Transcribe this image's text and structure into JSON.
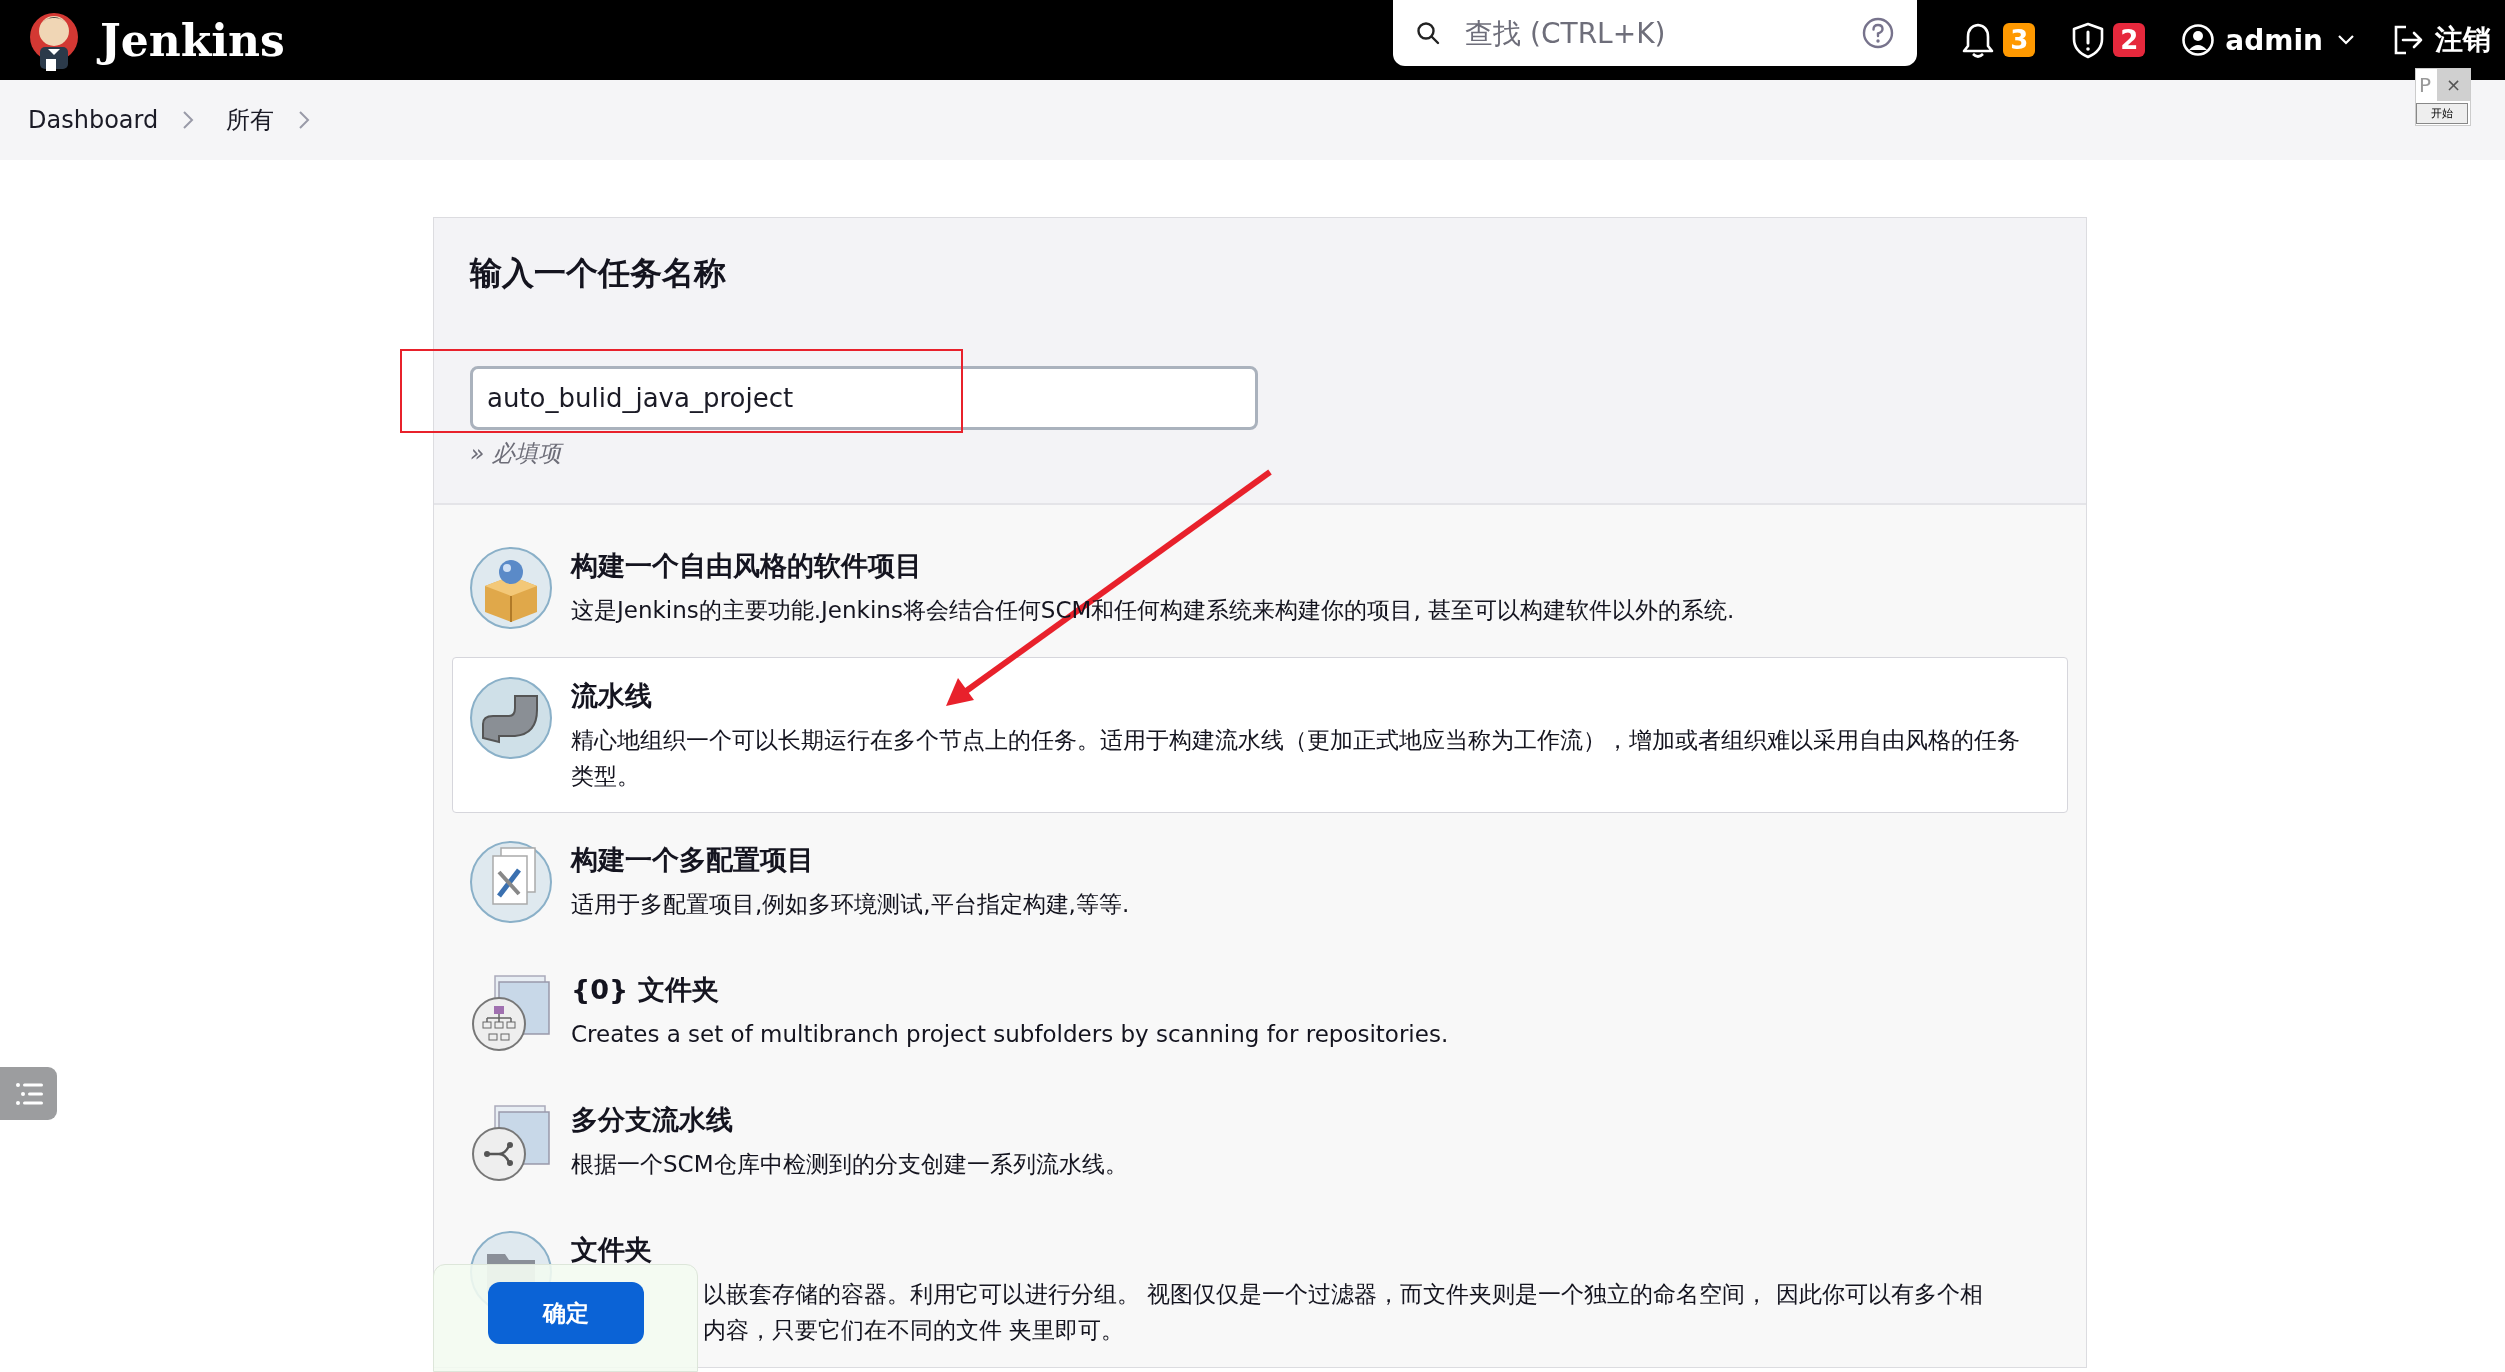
{
  "header": {
    "brand": "Jenkins",
    "search": {
      "placeholder": "查找 (CTRL+K)"
    },
    "notifications": "3",
    "security_alerts": "2",
    "user": "admin",
    "logout": "注销"
  },
  "breadcrumbs": [
    "Dashboard",
    "所有"
  ],
  "floating_widget": {
    "label": "P",
    "close": "×",
    "button": "开始"
  },
  "form": {
    "heading": "输入一个任务名称",
    "name_field": {
      "value": "auto_bulid_java_project"
    },
    "hint": "» 必填项"
  },
  "items": [
    {
      "kind": "freestyle",
      "title": "构建一个自由风格的软件项目",
      "description": "这是Jenkins的主要功能.Jenkins将会结合任何SCM和任何构建系统来构建你的项目, 甚至可以构建软件以外的系统.",
      "hovered": false
    },
    {
      "kind": "pipeline",
      "title": "流水线",
      "description": "精心地组织一个可以长期运行在多个节点上的任务。适用于构建流水线（更加正式地应当称为工作流），增加或者组织难以采用自由风格的任务类型。",
      "hovered": true
    },
    {
      "kind": "matrix",
      "title": "构建一个多配置项目",
      "description": "适用于多配置项目,例如多环境测试,平台指定构建,等等.",
      "hovered": false
    },
    {
      "kind": "org-folder",
      "title": "{0} 文件夹",
      "description": "Creates a set of multibranch project subfolders by scanning for repositories.",
      "hovered": false
    },
    {
      "kind": "multibranch",
      "title": "多分支流水线",
      "description": "根据一个SCM仓库中检测到的分支创建一系列流水线。",
      "hovered": false
    },
    {
      "kind": "folder",
      "title": "文件夹",
      "description_lines": [
        "以嵌套存储的容器。利用它可以进行分组。 视图仅仅是一个过滤器，而文件夹则是一个独立的命名空间， 因此你可以有多个相",
        "内容，只要它们在不同的文件 夹里即可。"
      ],
      "hovered": false
    }
  ],
  "submit": "确定"
}
